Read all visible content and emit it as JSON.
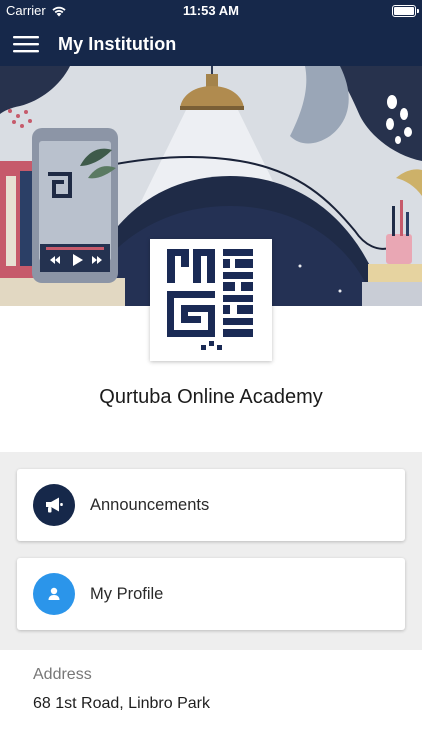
{
  "status_bar": {
    "carrier": "Carrier",
    "time": "11:53 AM",
    "battery_level": 1.0
  },
  "app_bar": {
    "title": "My Institution"
  },
  "institution": {
    "name": "Qurtuba Online Academy"
  },
  "cards": [
    {
      "label": "Announcements",
      "icon": "megaphone-icon",
      "color": "#16284a"
    },
    {
      "label": "My Profile",
      "icon": "person-icon",
      "color": "#2b95ea"
    }
  ],
  "address": {
    "label": "Address",
    "value": "68 1st Road, Linbro Park"
  },
  "colors": {
    "primary": "#16284a",
    "accent": "#2b95ea",
    "background_gray": "#eeeeee"
  }
}
